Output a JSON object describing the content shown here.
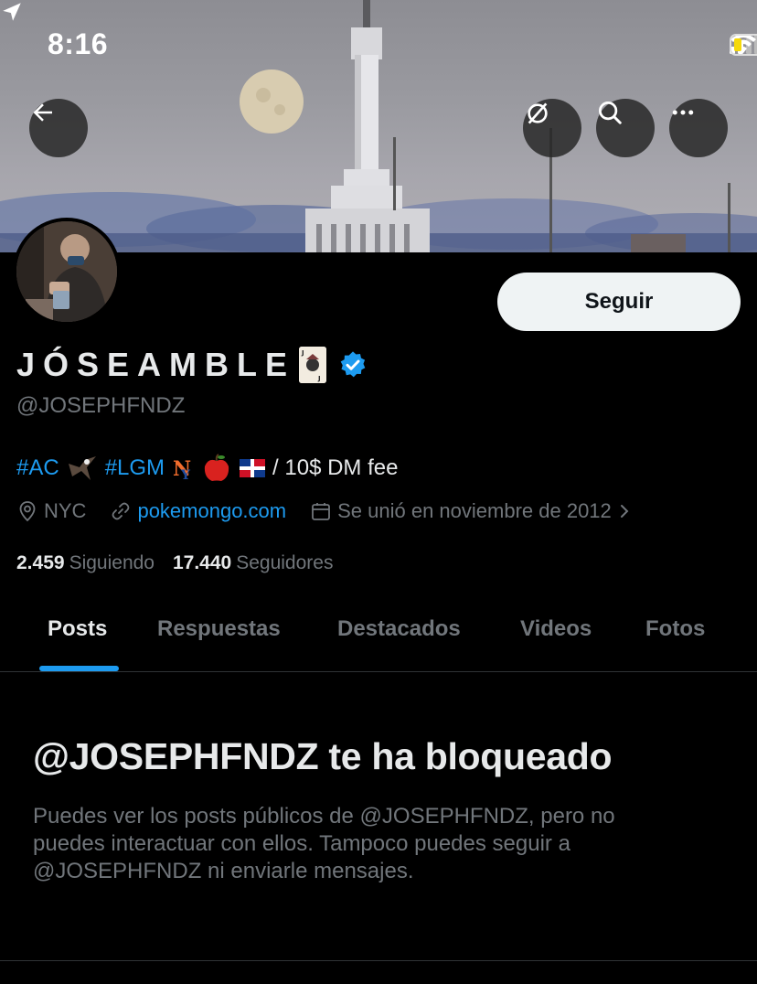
{
  "status_bar": {
    "time": "8:16"
  },
  "profile": {
    "display_name": "JÓSEAMBLE",
    "handle": "@JOSEPHFNDZ",
    "follow_label": "Seguir",
    "bio": {
      "tag1": "#AC",
      "tag2": "#LGM",
      "text": "/ 10$ DM fee"
    },
    "location": "NYC",
    "website": "pokemongo.com",
    "joined": "Se unió en noviembre de 2012",
    "following_count": "2.459",
    "following_label": "Siguiendo",
    "followers_count": "17.440",
    "followers_label": "Seguidores"
  },
  "tabs": [
    {
      "label": "Posts",
      "active": true
    },
    {
      "label": "Respuestas",
      "active": false
    },
    {
      "label": "Destacados",
      "active": false
    },
    {
      "label": "Videos",
      "active": false
    },
    {
      "label": "Fotos",
      "active": false
    }
  ],
  "blocked": {
    "title": "@JOSEPHFNDZ te ha bloqueado",
    "description": "Puedes ver los posts públicos de @JOSEPHFNDZ, pero no puedes interactuar con ellos. Tampoco puedes seguir a @JOSEPHFNDZ ni enviarle mensajes."
  },
  "icons": {
    "back": "arrow-left-icon",
    "unwatch": "eye-slash-icon",
    "search": "search-icon",
    "more": "more-icon",
    "location": "location-pin-icon",
    "link": "link-icon",
    "calendar": "calendar-icon",
    "verified": "verified-badge-icon"
  },
  "colors": {
    "accent": "#1d9bf0",
    "background": "#000000",
    "muted": "#71767b",
    "battery_low": "#f5d90a"
  }
}
